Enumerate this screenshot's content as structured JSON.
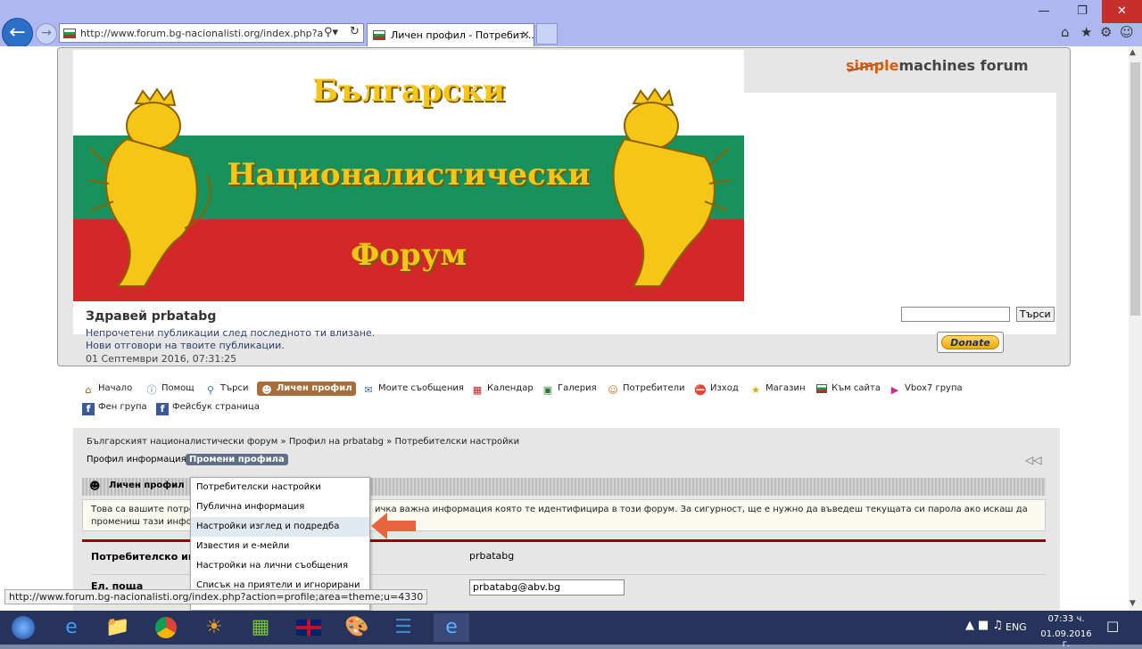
{
  "browser": {
    "address": "http://www.forum.bg-nacionalisti.org/index.php?action=",
    "tab_title": "Личен профил - Потребит...",
    "status_url": "http://www.forum.bg-nacionalisti.org/index.php?action=profile;area=theme;u=4330"
  },
  "header": {
    "logo_part1": "simple",
    "logo_part2": "machines forum",
    "banner_line1": "Български",
    "banner_line2": "Националистически",
    "banner_line3": "Форум",
    "greeting": "Здравей prbatabg",
    "unread_link": "Непрочетени публикации след последното ти влизане.",
    "replies_link": "Нови отговори на твоите публикации.",
    "datetime": "01 Септември 2016, 07:31:25",
    "search_button": "Търси",
    "donate_label": "Donate"
  },
  "menu": {
    "items": [
      {
        "label": "Начало",
        "icon": "house-icon"
      },
      {
        "label": "Помощ",
        "icon": "help-icon"
      },
      {
        "label": "Търси",
        "icon": "search-icon"
      },
      {
        "label": "Личен профил",
        "icon": "user-icon"
      },
      {
        "label": "Моите съобщения",
        "icon": "mail-icon"
      },
      {
        "label": "Календар",
        "icon": "calendar-icon"
      },
      {
        "label": "Галерия",
        "icon": "gallery-icon"
      },
      {
        "label": "Потребители",
        "icon": "users-icon"
      },
      {
        "label": "Изход",
        "icon": "logout-icon"
      },
      {
        "label": "Магазин",
        "icon": "star-icon"
      },
      {
        "label": "Към сайта",
        "icon": "flag-icon"
      },
      {
        "label": "Vbox7 група",
        "icon": "vbox-icon"
      },
      {
        "label": "Фен група",
        "icon": "facebook-icon"
      },
      {
        "label": "Фейсбук страница",
        "icon": "facebook-icon"
      }
    ]
  },
  "breadcrumb": {
    "item1": "Българският националистически форум",
    "item2": "Профил на prbatabg",
    "item3": "Потребителски настройки"
  },
  "subtabs": {
    "info": "Профил информация",
    "edit": "Промени профила"
  },
  "category": {
    "title": "Личен профил"
  },
  "info_text": {
    "line1_left": "Това са вашите потреб",
    "line1_right": "ичка важна информация която те идентифицира в този форум. За сигурност, ще е нужно да въведеш текущата си парола ако искаш да",
    "line2": "промениш тази инфор"
  },
  "form": {
    "username_label": "Потребителско им",
    "username_value": "prbatabg",
    "email_label": "Ел. поща",
    "email_value": "prbatabg@abv.bg"
  },
  "dropdown": {
    "items": [
      "Потребителски настройки",
      "Публична информация",
      "Настройки изглед и подредба",
      "Известия и е-мейли",
      "Настройки на лични съобщения",
      "Списък на приятели и игнорирани"
    ]
  },
  "taskbar": {
    "lang": "ENG",
    "time": "07:33 ч.",
    "date": "01.09.2016 г."
  },
  "colors": {
    "profile_tab": "#a66e3a",
    "edit_tab": "#5f6f84",
    "arrow": "#e8643c",
    "donate": "#f2a900"
  }
}
